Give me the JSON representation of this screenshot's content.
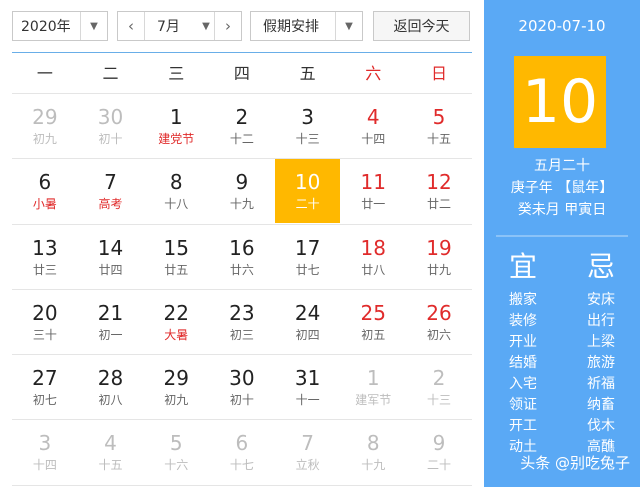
{
  "toolbar": {
    "year": "2020年",
    "month": "7月",
    "holiday": "假期安排",
    "back_today": "返回今天"
  },
  "weekdays": [
    "一",
    "二",
    "三",
    "四",
    "五",
    "六",
    "日"
  ],
  "calendar": [
    [
      {
        "d": "29",
        "l": "初九",
        "t": "other"
      },
      {
        "d": "30",
        "l": "初十",
        "t": "other"
      },
      {
        "d": "1",
        "l": "建党节",
        "t": "fest"
      },
      {
        "d": "2",
        "l": "十二"
      },
      {
        "d": "3",
        "l": "十三"
      },
      {
        "d": "4",
        "l": "十四",
        "t": "we"
      },
      {
        "d": "5",
        "l": "十五",
        "t": "we"
      }
    ],
    [
      {
        "d": "6",
        "l": "小暑",
        "t": "fest"
      },
      {
        "d": "7",
        "l": "高考",
        "t": "fest"
      },
      {
        "d": "8",
        "l": "十八"
      },
      {
        "d": "9",
        "l": "十九"
      },
      {
        "d": "10",
        "l": "二十",
        "t": "sel"
      },
      {
        "d": "11",
        "l": "廿一",
        "t": "we"
      },
      {
        "d": "12",
        "l": "廿二",
        "t": "we"
      }
    ],
    [
      {
        "d": "13",
        "l": "廿三"
      },
      {
        "d": "14",
        "l": "廿四"
      },
      {
        "d": "15",
        "l": "廿五"
      },
      {
        "d": "16",
        "l": "廿六"
      },
      {
        "d": "17",
        "l": "廿七"
      },
      {
        "d": "18",
        "l": "廿八",
        "t": "we"
      },
      {
        "d": "19",
        "l": "廿九",
        "t": "we"
      }
    ],
    [
      {
        "d": "20",
        "l": "三十"
      },
      {
        "d": "21",
        "l": "初一"
      },
      {
        "d": "22",
        "l": "大暑",
        "t": "fest"
      },
      {
        "d": "23",
        "l": "初三"
      },
      {
        "d": "24",
        "l": "初四"
      },
      {
        "d": "25",
        "l": "初五",
        "t": "we"
      },
      {
        "d": "26",
        "l": "初六",
        "t": "we"
      }
    ],
    [
      {
        "d": "27",
        "l": "初七"
      },
      {
        "d": "28",
        "l": "初八"
      },
      {
        "d": "29",
        "l": "初九"
      },
      {
        "d": "30",
        "l": "初十"
      },
      {
        "d": "31",
        "l": "十一"
      },
      {
        "d": "1",
        "l": "建军节",
        "t": "other"
      },
      {
        "d": "2",
        "l": "十三",
        "t": "other"
      }
    ],
    [
      {
        "d": "3",
        "l": "十四",
        "t": "other"
      },
      {
        "d": "4",
        "l": "十五",
        "t": "other"
      },
      {
        "d": "5",
        "l": "十六",
        "t": "other"
      },
      {
        "d": "6",
        "l": "十七",
        "t": "other"
      },
      {
        "d": "7",
        "l": "立秋",
        "t": "other"
      },
      {
        "d": "8",
        "l": "十九",
        "t": "other"
      },
      {
        "d": "9",
        "l": "二十",
        "t": "other"
      }
    ]
  ],
  "panel": {
    "date": "2020-07-10",
    "day": "10",
    "lunar": "五月二十",
    "year_gz": "庚子年 【鼠年】",
    "month_day_gz": "癸未月 甲寅日",
    "yi_title": "宜",
    "ji_title": "忌",
    "yi": [
      "搬家",
      "装修",
      "开业",
      "结婚",
      "入宅",
      "领证",
      "开工",
      "动土"
    ],
    "ji": [
      "安床",
      "出行",
      "上梁",
      "旅游",
      "祈福",
      "纳畜",
      "伐木",
      "高醮"
    ]
  },
  "watermark": "头条 @别吃兔子"
}
